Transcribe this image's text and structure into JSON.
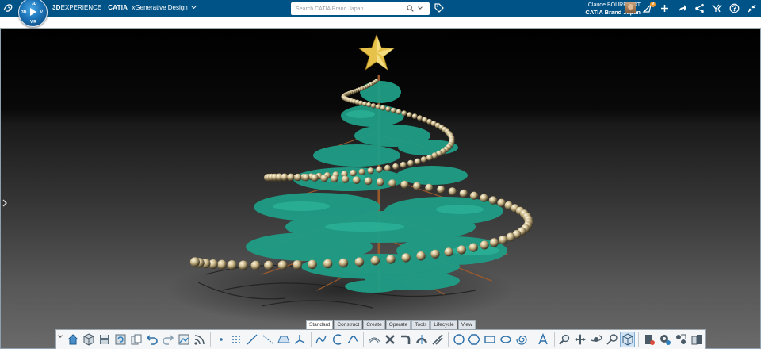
{
  "app": {
    "platform_bold": "3D",
    "platform": "EXPERIENCE",
    "brand": "CATIA",
    "app_name": "xGenerative Design"
  },
  "compass": {
    "top": "3D",
    "left": "3D",
    "right": "V",
    "bottom": "V.R"
  },
  "search": {
    "placeholder": "Search CATIA Brand Japan"
  },
  "user": {
    "name": "Claude BOURBIGOT",
    "collaborative_space": "CATIA Brand Japan"
  },
  "notifications": {
    "count": "9"
  },
  "icons": {
    "topbar": [
      "ds-logo-icon",
      "compass-icon",
      "search-icon",
      "tag-icon",
      "avatar",
      "notification-icon",
      "add-icon",
      "share-icon",
      "network-icon",
      "apps-icon",
      "help-icon",
      "collapse-icon"
    ],
    "toolbar": [
      "home-icon",
      "cube-icon",
      "save-icon",
      "refresh-icon",
      "copy-icon",
      "undo-icon",
      "redo-icon",
      "image-icon",
      "feed-icon",
      "point-icon",
      "grid-points-icon",
      "line-icon",
      "dashed-line-icon",
      "plane-icon",
      "axis-icon",
      "spline-icon",
      "arc-icon",
      "curve-icon",
      "sweep-icon",
      "twist-icon",
      "blend-icon",
      "split-icon",
      "trim-icon",
      "circle-icon",
      "polygon-icon",
      "rectangle-icon",
      "ellipse-icon",
      "spiral-icon",
      "text-icon",
      "zoom-icon",
      "pan-icon",
      "rotate-icon",
      "look-icon",
      "view-cube-icon",
      "document-icon",
      "settings-icon",
      "render-icon",
      "display-icon"
    ]
  },
  "tabs": [
    {
      "label": "Standard",
      "active": true
    },
    {
      "label": "Construct",
      "active": false
    },
    {
      "label": "Create",
      "active": false
    },
    {
      "label": "Operate",
      "active": false
    },
    {
      "label": "Tools",
      "active": false
    },
    {
      "label": "Lifecycle",
      "active": false
    },
    {
      "label": "View",
      "active": false
    }
  ],
  "colors": {
    "topbar": "#005386",
    "foliage": "#1f9d86",
    "bead": "#d9c79a",
    "star": "#e7c24a",
    "trunk": "#9b5a2c"
  }
}
